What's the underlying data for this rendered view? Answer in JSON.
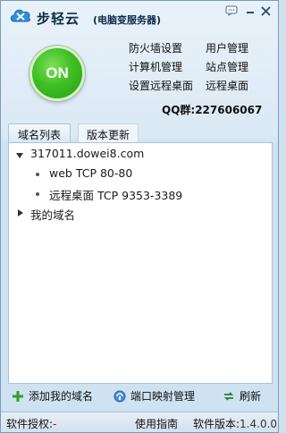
{
  "window": {
    "title": "步轻云",
    "subtitle": "(电脑变服务器)"
  },
  "status": {
    "power": "ON"
  },
  "menu": {
    "firewall": "防火墙设置",
    "user_mgmt": "用户管理",
    "computer_mgmt": "计算机管理",
    "site_mgmt": "站点管理",
    "remote_settings": "设置远程桌面",
    "remote_desktop": "远程桌面"
  },
  "qq_label": "QQ群:227606067",
  "tabs": [
    {
      "label": "域名列表",
      "active": true
    },
    {
      "label": "版本更新",
      "active": false
    }
  ],
  "tree": {
    "domain": "317011.dowei8.com",
    "children": [
      "web TCP 80-80",
      "远程桌面 TCP 9353-3389"
    ],
    "my_domains": "我的域名"
  },
  "toolbar": {
    "add": "添加我的域名",
    "port_mapping": "端口映射管理",
    "refresh": "刷新"
  },
  "statusbar": {
    "license_label": "软件授权:",
    "license_value": "-",
    "guide": "使用指南",
    "version_label": "软件版本:",
    "version_value": "1.4.0.0"
  },
  "colors": {
    "accent": "#3fbf24",
    "frame": "#7a9cb8",
    "panel_border": "#a9c3d8"
  },
  "icons": {
    "logo": "cloud-logo-icon",
    "chat": "chat-icon",
    "minimize": "minimize-icon",
    "close": "close-icon",
    "add": "plus-icon",
    "port": "port-mapping-icon",
    "refresh": "refresh-icon"
  }
}
